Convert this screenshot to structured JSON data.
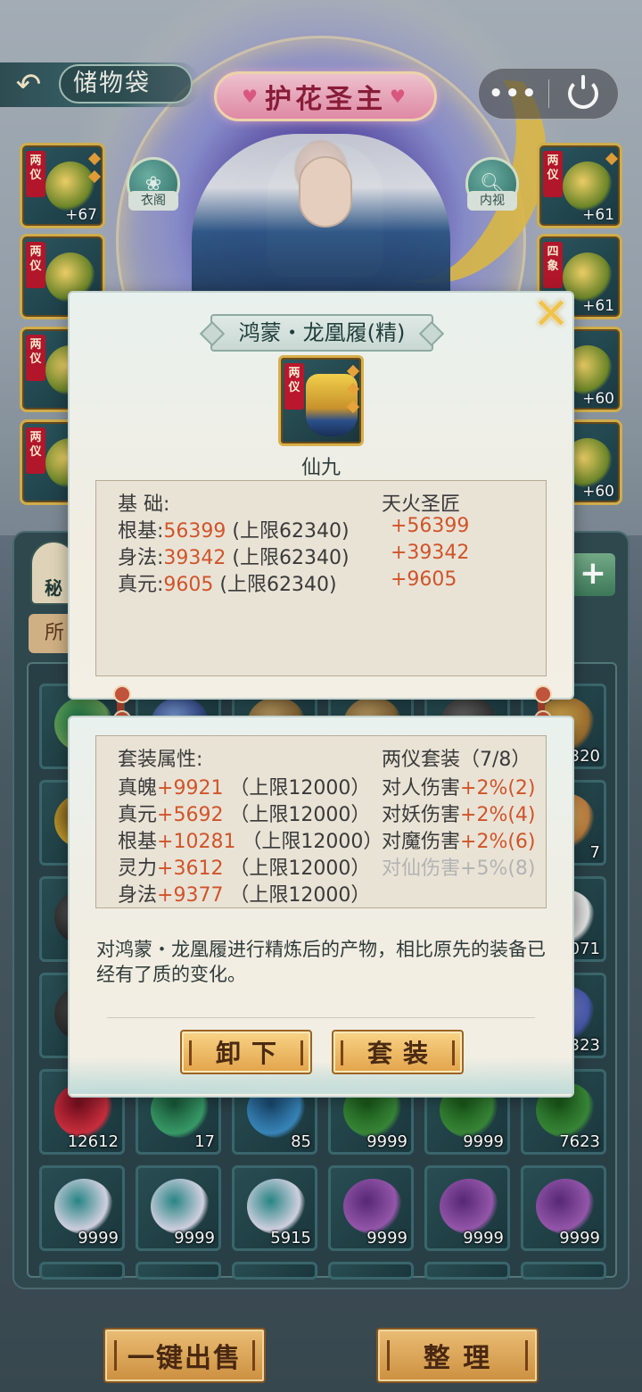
{
  "header": {
    "back_icon": "back-arrow-icon",
    "bag_title": "储物袋",
    "banner_title": "护花圣主",
    "capsule_more": "•••",
    "capsule_power_icon": "power-icon"
  },
  "character": {
    "wardrobe_label": "衣阁",
    "inspect_label": "内视"
  },
  "equip_left": [
    {
      "tag": "两仪",
      "level": "+67"
    },
    {
      "tag": "两仪",
      "level": ""
    },
    {
      "tag": "两仪",
      "level": ""
    },
    {
      "tag": "两仪",
      "level": ""
    }
  ],
  "equip_right": [
    {
      "tag": "两仪",
      "level": "+61"
    },
    {
      "tag": "四象",
      "level": "+61"
    },
    {
      "tag": "",
      "level": "+60"
    },
    {
      "tag": "",
      "level": "+60"
    }
  ],
  "inventory": {
    "side_tab": "秘",
    "filter_tab": "所",
    "add_label": "+",
    "rows": [
      [
        "",
        "",
        "",
        "",
        "",
        "320"
      ],
      [
        "",
        "",
        "",
        "",
        "",
        "7"
      ],
      [
        "",
        "",
        "",
        "",
        "",
        "071"
      ],
      [
        "",
        "",
        "",
        "",
        "",
        "323"
      ],
      [
        "12612",
        "17",
        "85",
        "9999",
        "9999",
        "7623"
      ],
      [
        "9999",
        "9999",
        "5915",
        "9999",
        "9999",
        "9999"
      ]
    ]
  },
  "bottom_buttons": {
    "sell_all": "一键出售",
    "sort": "整 理"
  },
  "popup": {
    "close_icon": "close-icon",
    "item_name": "鸿蒙・龙凰履(精)",
    "item_tag": "两仪",
    "item_grade": "仙九",
    "base": {
      "header_left": "基 础:",
      "header_right": "天火圣匠",
      "rows": [
        {
          "label": "根基:",
          "value": "56399",
          "cap": " (上限62340)",
          "bonus": "+56399"
        },
        {
          "label": "身法:",
          "value": "39342",
          "cap": " (上限62340)",
          "bonus": "+39342"
        },
        {
          "label": "真元:",
          "value": "9605",
          "cap": " (上限62340)",
          "bonus": "+9605"
        }
      ]
    },
    "set": {
      "header_left": "套装属性:",
      "header_right": "两仪套装（7/8）",
      "rows": [
        {
          "label": "真魄",
          "value": "+9921",
          "cap": " （上限12000）"
        },
        {
          "label": "真元",
          "value": "+5692",
          "cap": " （上限12000）"
        },
        {
          "label": "根基",
          "value": "+10281",
          "cap": " （上限12000）"
        },
        {
          "label": "灵力",
          "value": "+3612",
          "cap": " （上限12000）"
        },
        {
          "label": "身法",
          "value": "+9377",
          "cap": " （上限12000）"
        }
      ],
      "bonuses": [
        {
          "label": "对人伤害",
          "value": "+2%(2)",
          "active": true
        },
        {
          "label": "对妖伤害",
          "value": "+2%(4)",
          "active": true
        },
        {
          "label": "对魔伤害",
          "value": "+2%(6)",
          "active": true
        },
        {
          "label": "对仙伤害",
          "value": "+5%(8)",
          "active": false
        }
      ]
    },
    "description": "对鸿蒙・龙凰履进行精炼后的产物，相比原先的装备已经有了质的变化。",
    "unequip_label": "卸下",
    "set_label": "套装"
  },
  "colors": {
    "accent_orange": "#d0542a",
    "gold_border": "#d9b54f",
    "tag_red": "#b9172d"
  }
}
